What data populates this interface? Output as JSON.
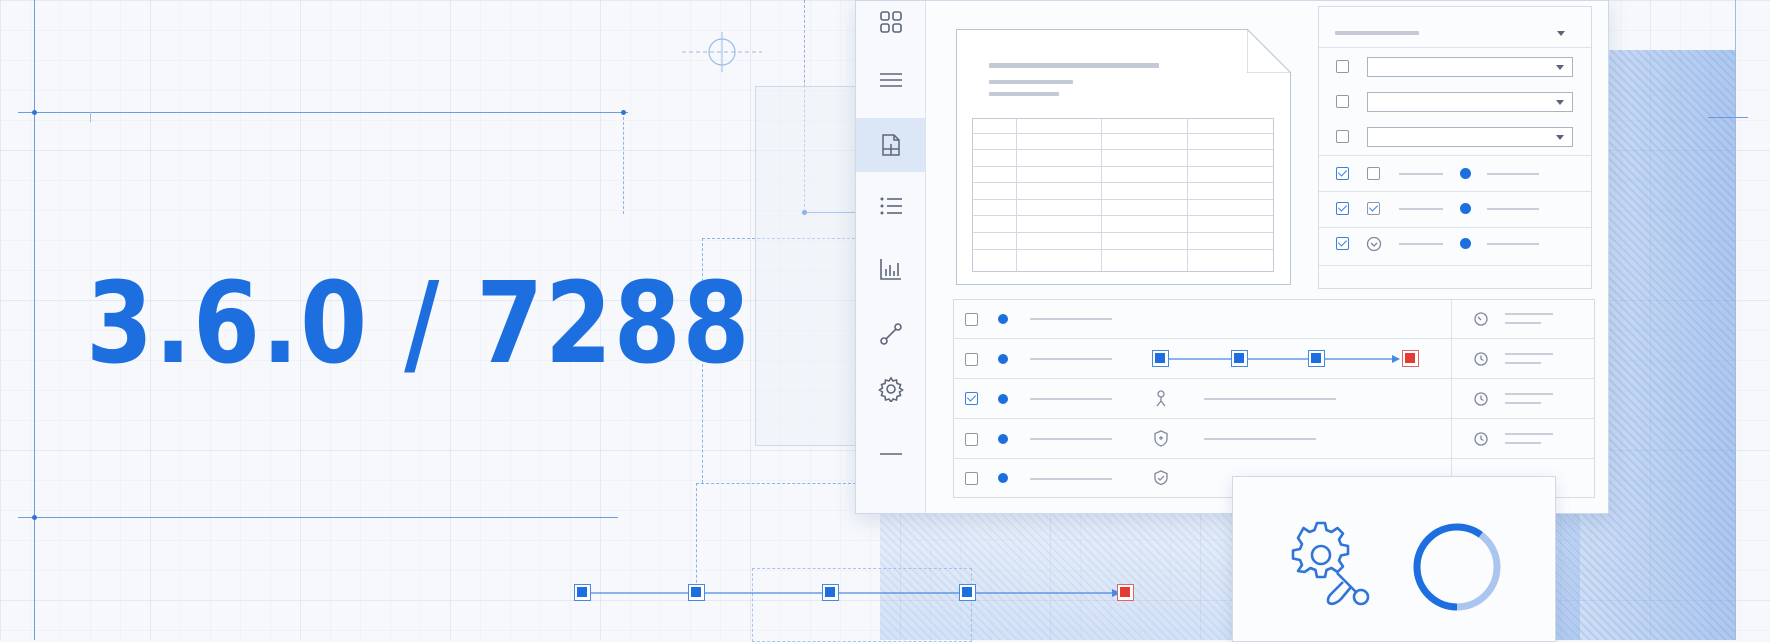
{
  "version_label": "3.6.0 / 7288",
  "colors": {
    "accent": "#1d6fe0",
    "end_node": "#e53b35",
    "background": "#f6f8fb",
    "line": "#6b9be0"
  },
  "sidebar": {
    "items": [
      {
        "icon": "grid-icon",
        "active": false
      },
      {
        "icon": "menu-icon",
        "active": false
      },
      {
        "icon": "document-icon",
        "active": true
      },
      {
        "icon": "list-icon",
        "active": false
      },
      {
        "icon": "bar-chart-icon",
        "active": false
      },
      {
        "icon": "connection-icon",
        "active": false
      },
      {
        "icon": "gear-icon",
        "active": false
      },
      {
        "icon": "minus-icon",
        "active": false
      }
    ]
  },
  "form": {
    "selects": 3,
    "checked_rows": [
      true,
      true,
      true
    ]
  },
  "list_rows": [
    {
      "checked": false,
      "icon": "gauge-icon"
    },
    {
      "checked": false,
      "icon": "clock-icon"
    },
    {
      "checked": true,
      "icon": "clock-icon"
    },
    {
      "checked": false,
      "icon": "clock-icon"
    },
    {
      "checked": false,
      "icon": ""
    }
  ],
  "progress_ring": {
    "fraction": 0.6
  }
}
